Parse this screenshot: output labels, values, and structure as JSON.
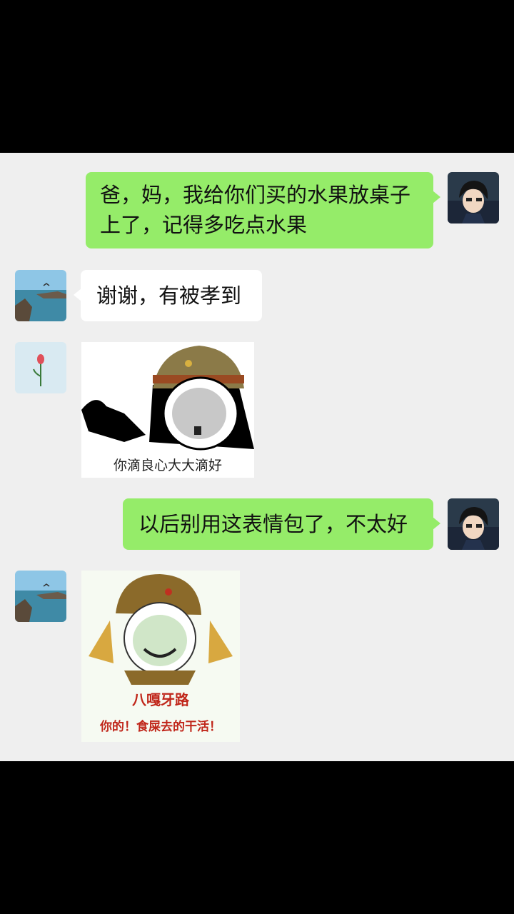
{
  "messages": {
    "m1": {
      "text": "爸，妈，我给你们买的水果放桌子上了，记得多吃点水果"
    },
    "m2": {
      "text": "谢谢，有被孝到"
    },
    "m3": {
      "caption": "你滴良心大大滴好"
    },
    "m4": {
      "text": "以后别用这表情包了，不太好"
    },
    "m5": {
      "line1": "八嘎牙路",
      "line2": "你的！食屎去的干活！"
    }
  },
  "colors": {
    "sent_bubble": "#95ec69",
    "received_bubble": "#ffffff",
    "chat_bg": "#efefef",
    "letterbox": "#000000"
  },
  "icons": {
    "self_avatar": "anime-boy-avatar",
    "mom_avatar": "seaside-photo-avatar",
    "dad_avatar": "rose-flower-avatar"
  }
}
